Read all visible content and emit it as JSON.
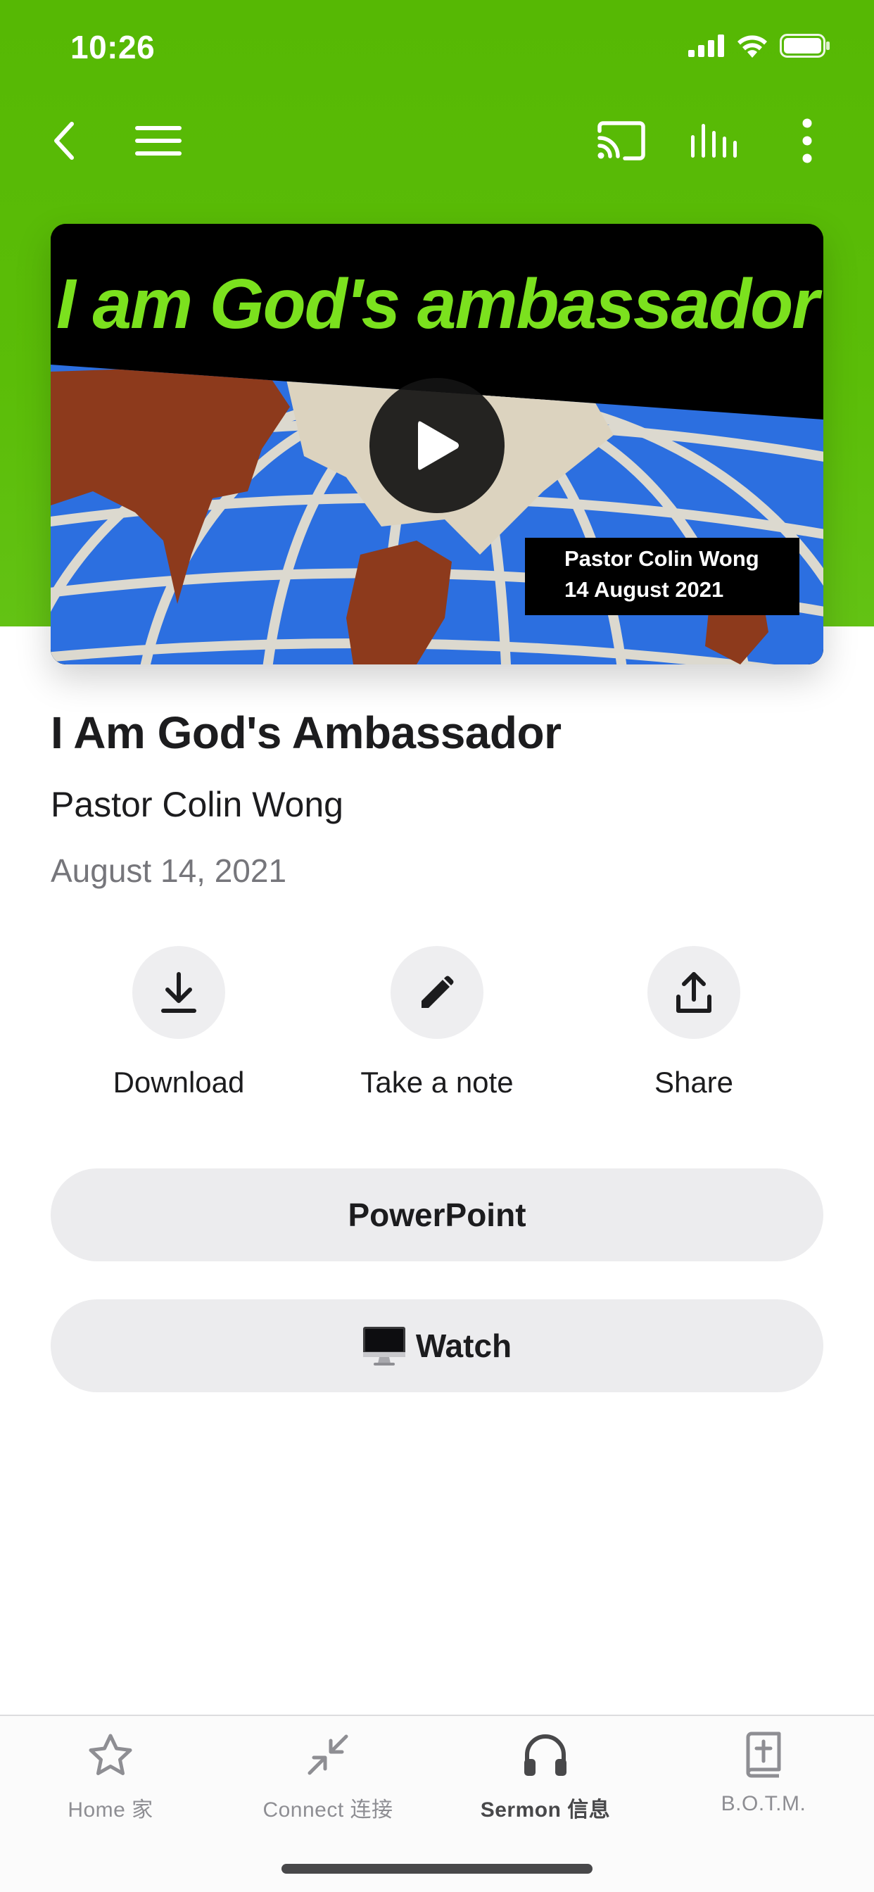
{
  "status_bar": {
    "time": "10:26"
  },
  "nav": {
    "icons": [
      "back-chevron-icon",
      "menu-icon",
      "cast-icon",
      "audio-bars-icon",
      "more-vertical-icon"
    ]
  },
  "hero": {
    "artwork_title": "I am God's ambassador",
    "caption_line1": "Pastor Colin Wong",
    "caption_line2": "14 August 2021",
    "accent_color": "#7be11e"
  },
  "sermon": {
    "title": "I Am God's Ambassador",
    "speaker": "Pastor Colin Wong",
    "date": "August 14, 2021"
  },
  "actions": [
    {
      "label": "Download",
      "icon": "download-icon"
    },
    {
      "label": "Take a note",
      "icon": "pencil-icon"
    },
    {
      "label": "Share",
      "icon": "share-icon"
    }
  ],
  "buttons": {
    "powerpoint": "PowerPoint",
    "watch": "Watch",
    "watch_icon": "desktop-computer-icon"
  },
  "tabs": [
    {
      "label": "Home 家",
      "icon": "star-icon",
      "active": false
    },
    {
      "label": "Connect 连接",
      "icon": "arrows-in-icon",
      "active": false
    },
    {
      "label": "Sermon 信息",
      "icon": "headphones-icon",
      "active": true
    },
    {
      "label": "B.O.T.M.",
      "icon": "bible-cross-icon",
      "active": false
    }
  ],
  "colors": {
    "brand_green": "#56b804",
    "tab_active": "#48484a",
    "tab_inactive": "#8e8e93"
  }
}
